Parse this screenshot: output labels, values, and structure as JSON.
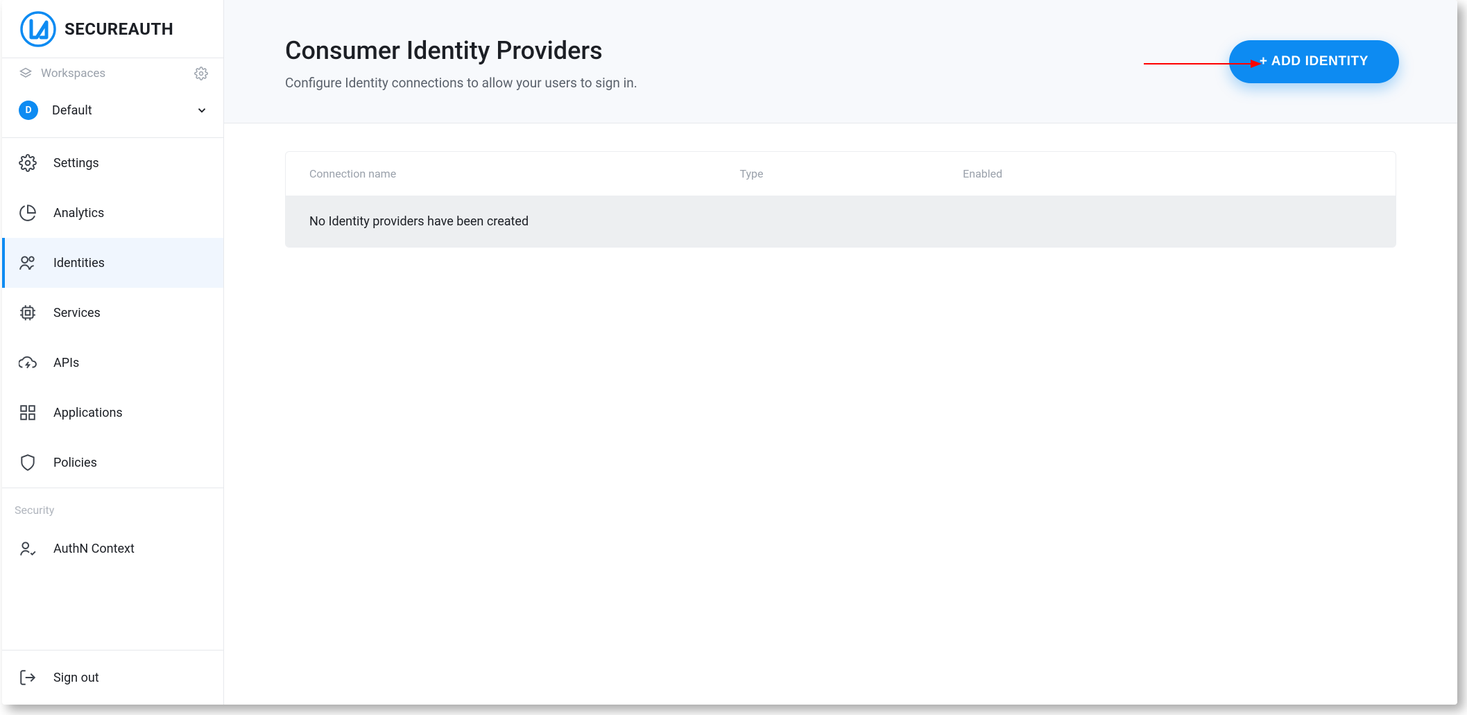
{
  "brand": {
    "name": "SECUREAUTH"
  },
  "sidebar": {
    "workspaces_label": "Workspaces",
    "current_workspace": {
      "initial": "D",
      "name": "Default"
    },
    "nav": [
      {
        "id": "settings",
        "label": "Settings"
      },
      {
        "id": "analytics",
        "label": "Analytics"
      },
      {
        "id": "identities",
        "label": "Identities"
      },
      {
        "id": "services",
        "label": "Services"
      },
      {
        "id": "apis",
        "label": "APIs"
      },
      {
        "id": "applications",
        "label": "Applications"
      },
      {
        "id": "policies",
        "label": "Policies"
      }
    ],
    "security_section": "Security",
    "security_nav": [
      {
        "id": "authn-context",
        "label": "AuthN Context"
      }
    ],
    "signout": "Sign out"
  },
  "page": {
    "title": "Consumer Identity Providers",
    "subtitle": "Configure Identity connections to allow your users to sign in.",
    "add_button": "+ ADD IDENTITY"
  },
  "table": {
    "columns": {
      "name": "Connection name",
      "type": "Type",
      "enabled": "Enabled"
    },
    "empty_message": "No Identity providers have been created"
  }
}
